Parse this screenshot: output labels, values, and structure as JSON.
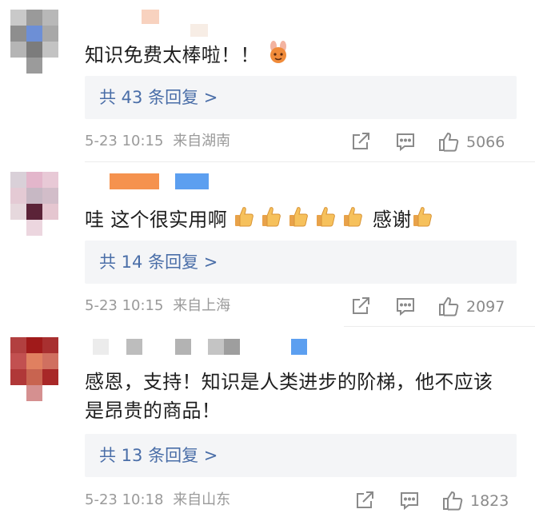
{
  "comments": [
    {
      "text": "知识免费太棒啦！！",
      "reply_label": "共 43 条回复 >",
      "time": "5-23 10:15",
      "location": "来自湖南",
      "likes": "5066"
    },
    {
      "text_prefix": "哇 这个很实用啊",
      "text_suffix": "感谢",
      "reply_label": "共 14 条回复 >",
      "time": "5-23 10:15",
      "location": "来自上海",
      "likes": "2097"
    },
    {
      "text": "感恩，支持！知识是人类进步的阶梯，他不应该是昂贵的商品！",
      "reply_label": "共 13 条回复 >",
      "time": "5-23 10:18",
      "location": "来自山东",
      "likes": "1823"
    }
  ],
  "icons": {
    "share": "share-icon",
    "comment": "comment-icon",
    "like": "thumbs-up-icon",
    "emoji_thumb": "thumbs-up-emoji",
    "emoji_bunny": "bunny-hands-emoji"
  },
  "colors": {
    "reply_link": "#4a6ea8",
    "reply_bg": "#f4f5f7",
    "meta_text": "#9a9a9a"
  }
}
